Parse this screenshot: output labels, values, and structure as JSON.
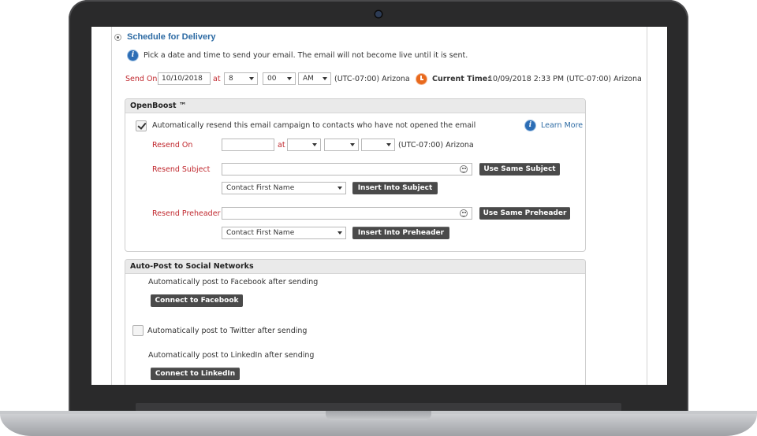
{
  "schedule": {
    "title": "Schedule for Delivery",
    "info_text": "Pick a date and time to send your email. The email will not become live until it is sent.",
    "send_on_label": "Send On",
    "date_value": "10/10/2018",
    "at_label": "at",
    "hour_value": "8",
    "minute_value": "00",
    "ampm_value": "AM",
    "timezone": "(UTC-07:00) Arizona",
    "current_time_label": "Current Time:",
    "current_time_value": "10/09/2018 2:33 PM (UTC-07:00) Arizona"
  },
  "openboost": {
    "header": "OpenBoost ™",
    "resend_checkbox_label": "Automatically resend this email campaign to contacts who have not opened the email",
    "resend_checked": true,
    "learn_more": "Learn More",
    "resend_on_label": "Resend On",
    "resend_date_value": "",
    "at_label": "at",
    "resend_hour_value": "",
    "resend_minute_value": "",
    "resend_ampm_value": "",
    "timezone": "(UTC-07:00) Arizona",
    "resend_subject_label": "Resend Subject",
    "resend_subject_value": "",
    "use_same_subject": "Use Same Subject",
    "subject_merge_select": "Contact First Name",
    "insert_into_subject": "Insert Into Subject",
    "resend_preheader_label": "Resend Preheader",
    "resend_preheader_value": "",
    "use_same_preheader": "Use Same Preheader",
    "preheader_merge_select": "Contact First Name",
    "insert_into_preheader": "Insert Into Preheader"
  },
  "social": {
    "header": "Auto-Post to Social Networks",
    "facebook_text": "Automatically post to Facebook after sending",
    "connect_facebook": "Connect to Facebook",
    "twitter_text": "Automatically post to Twitter after sending",
    "twitter_checked": false,
    "linkedin_text": "Automatically post to LinkedIn after sending",
    "connect_linkedin": "Connect to LinkedIn"
  },
  "colors": {
    "title_blue": "#2c6aa3",
    "required_red": "#c0272d",
    "button_dark": "#4a4a4a",
    "clock_orange": "#e8691d",
    "info_blue": "#2c6db5"
  }
}
